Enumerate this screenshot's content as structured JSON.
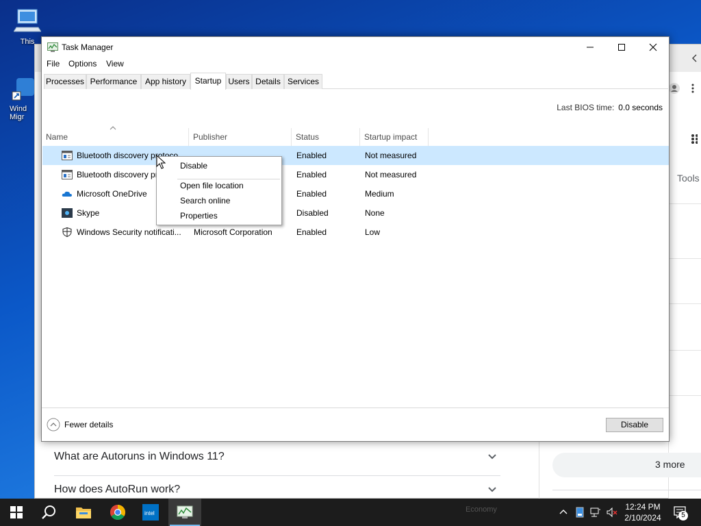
{
  "desktop": {
    "icons": [
      {
        "label": "This"
      },
      {
        "label": "Wind\nMigr"
      }
    ]
  },
  "browser": {
    "tools_label": "Tools",
    "faq": [
      {
        "question": "What are Autoruns in Windows 11?"
      },
      {
        "question": "How does AutoRun work?"
      }
    ],
    "more_label": "3 more"
  },
  "task_manager": {
    "title": "Task Manager",
    "menu": [
      "File",
      "Options",
      "View"
    ],
    "tabs": [
      "Processes",
      "Performance",
      "App history",
      "Startup",
      "Users",
      "Details",
      "Services"
    ],
    "active_tab": "Startup",
    "bios_label": "Last BIOS time:",
    "bios_value": "0.0 seconds",
    "columns": [
      "Name",
      "Publisher",
      "Status",
      "Startup impact"
    ],
    "rows": [
      {
        "icon": "generic-app-icon",
        "name": "Bluetooth discovery protoco",
        "publisher": "",
        "status": "Enabled",
        "impact": "Not measured"
      },
      {
        "icon": "generic-app-icon",
        "name": "Bluetooth discovery pr",
        "publisher": "",
        "status": "Enabled",
        "impact": "Not measured"
      },
      {
        "icon": "onedrive-icon",
        "name": "Microsoft OneDrive",
        "publisher": "",
        "status": "Enabled",
        "impact": "Medium"
      },
      {
        "icon": "skype-icon",
        "name": "Skype",
        "publisher": "",
        "status": "Disabled",
        "impact": "None"
      },
      {
        "icon": "shield-icon",
        "name": "Windows Security notificati...",
        "publisher": "Microsoft Corporation",
        "status": "Enabled",
        "impact": "Low"
      }
    ],
    "context_menu": [
      "Disable",
      "Open file location",
      "Search online",
      "Properties"
    ],
    "footer": {
      "fewer_details": "Fewer details",
      "disable_button": "Disable"
    }
  },
  "taskbar": {
    "ghost_text": "Economy",
    "clock_time": "12:24 PM",
    "clock_date": "2/10/2024",
    "notification_count": "5",
    "colors": {
      "accent": "#76b9ed",
      "taskbar": "#1c1c1c",
      "selection": "#cce8ff"
    }
  }
}
